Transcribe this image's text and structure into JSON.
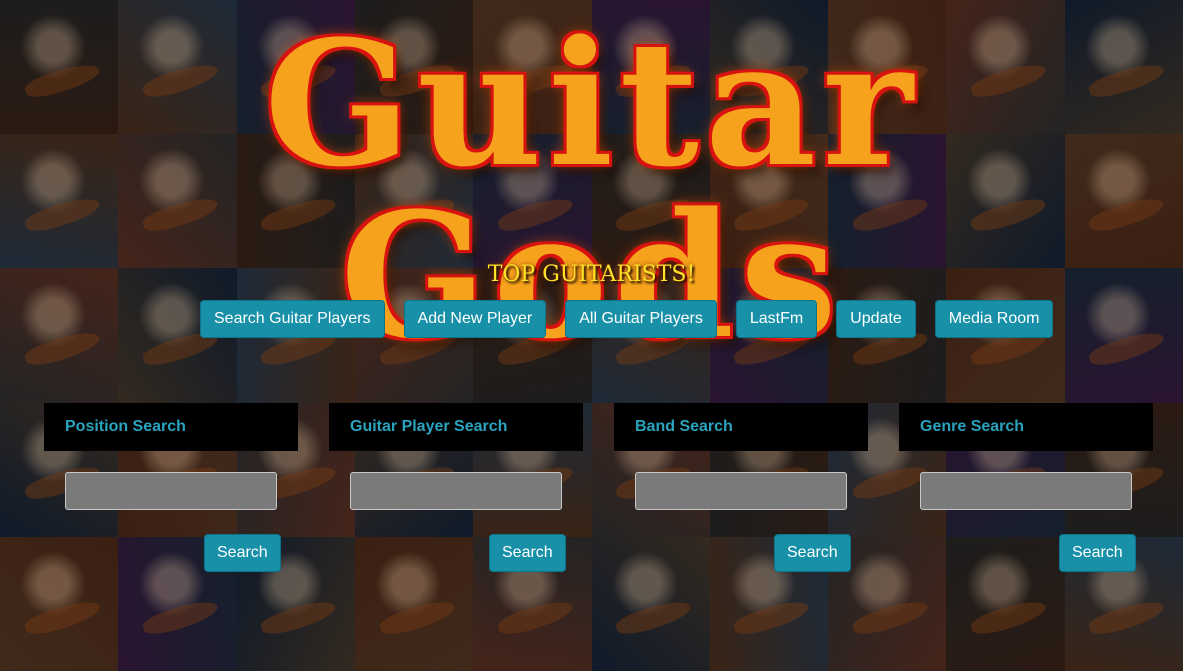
{
  "site": {
    "title": "Guitar Gods",
    "subtitle": "TOP GUITARISTS!"
  },
  "nav": {
    "items": [
      {
        "label": "Search Guitar Players"
      },
      {
        "label": "Add New Player"
      },
      {
        "label": "All Guitar Players"
      },
      {
        "label": "LastFm"
      },
      {
        "label": "Update"
      },
      {
        "label": "Media Room"
      }
    ]
  },
  "search": {
    "panels": [
      {
        "heading": "Position Search",
        "value": "",
        "button_label": "Search"
      },
      {
        "heading": "Guitar Player Search",
        "value": "",
        "button_label": "Search"
      },
      {
        "heading": "Band Search",
        "value": "",
        "button_label": "Search"
      },
      {
        "heading": "Genre Search",
        "value": "",
        "button_label": "Search"
      }
    ]
  },
  "colors": {
    "button": "#1790a8",
    "heading_text": "#2aa3bf",
    "title_fill": "#f6a21c",
    "title_outline": "#d8130f",
    "subtitle": "#ffe227"
  },
  "background": {
    "description_icon": "guitarist-photo-collage"
  }
}
